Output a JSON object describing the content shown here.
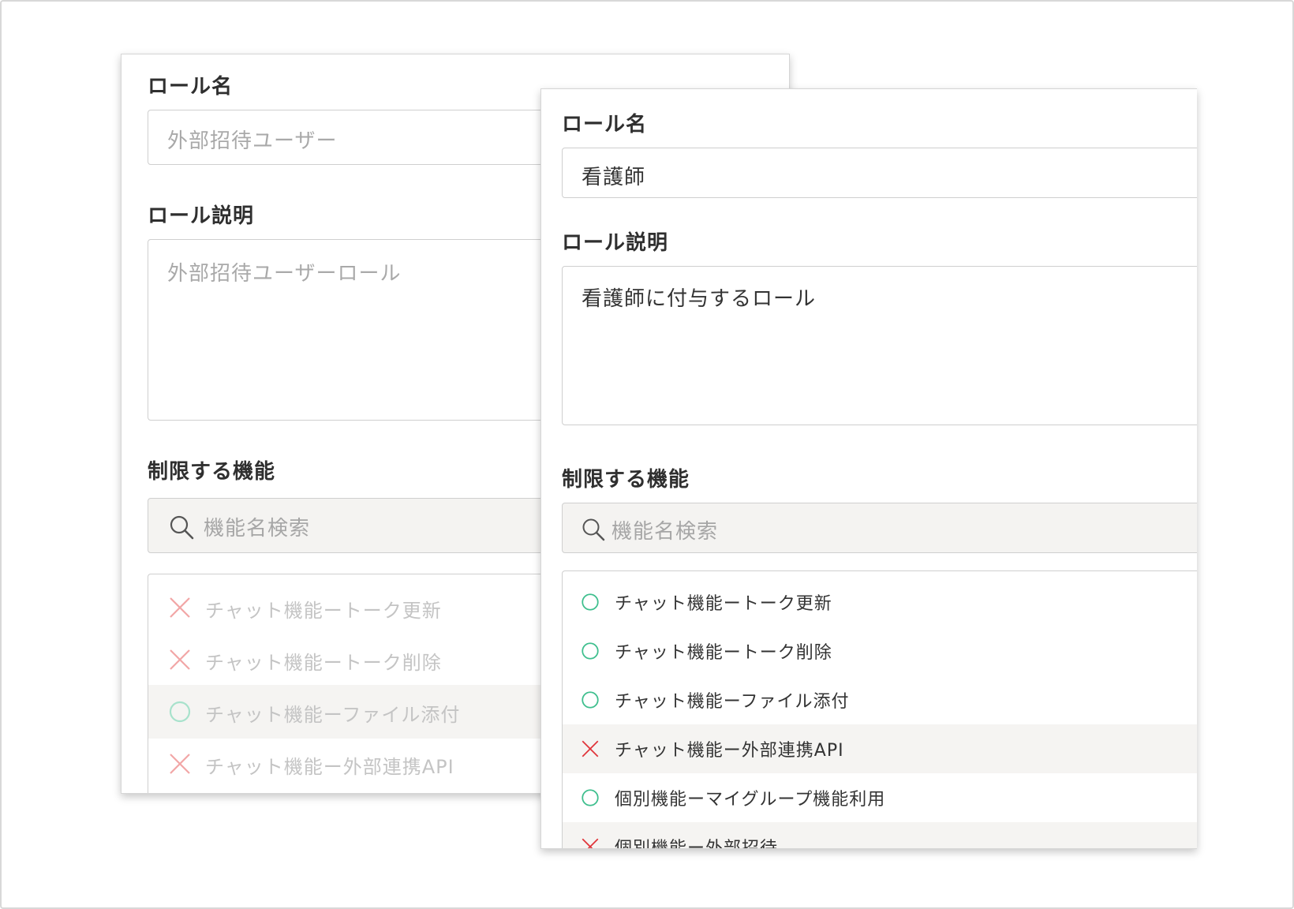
{
  "back_form": {
    "role_name_label": "ロール名",
    "role_name_placeholder": "外部招待ユーザー",
    "role_desc_label": "ロール説明",
    "role_desc_placeholder": "外部招待ユーザーロール",
    "restricted_label": "制限する機能",
    "search_placeholder": "機能名検索",
    "features": [
      {
        "label": "チャット機能ートーク更新",
        "status": "restricted",
        "shaded": false
      },
      {
        "label": "チャット機能ートーク削除",
        "status": "restricted",
        "shaded": false
      },
      {
        "label": "チャット機能ーファイル添付",
        "status": "allowed",
        "shaded": true
      },
      {
        "label": "チャット機能ー外部連携API",
        "status": "restricted",
        "shaded": false
      }
    ]
  },
  "front_form": {
    "role_name_label": "ロール名",
    "role_name_value": "看護師",
    "role_desc_label": "ロール説明",
    "role_desc_value": "看護師に付与するロール",
    "restricted_label": "制限する機能",
    "search_placeholder": "機能名検索",
    "features": [
      {
        "label": "チャット機能ートーク更新",
        "status": "allowed",
        "shaded": false
      },
      {
        "label": "チャット機能ートーク削除",
        "status": "allowed",
        "shaded": false
      },
      {
        "label": "チャット機能ーファイル添付",
        "status": "allowed",
        "shaded": false
      },
      {
        "label": "チャット機能ー外部連携API",
        "status": "restricted",
        "shaded": true
      },
      {
        "label": "個別機能ーマイグループ機能利用",
        "status": "allowed",
        "shaded": false
      },
      {
        "label": "個別機能ー外部招待",
        "status": "restricted",
        "shaded": true
      }
    ]
  },
  "icons": {
    "allowed": "circle-icon",
    "restricted": "x-icon",
    "search": "search-icon"
  }
}
